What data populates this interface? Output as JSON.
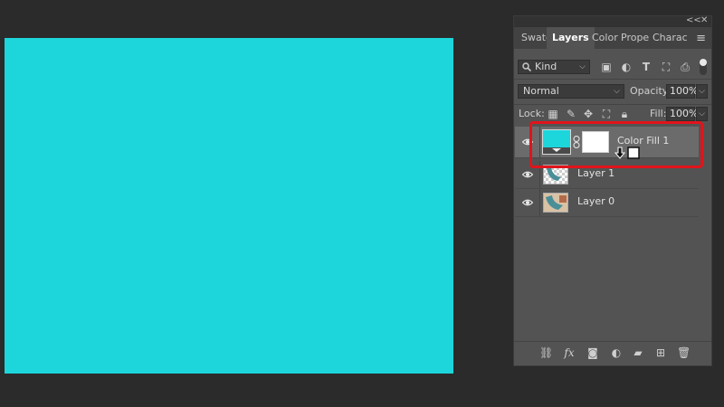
{
  "canvas": {
    "fill_color": "#1dd6dc"
  },
  "panel": {
    "window_controls": {
      "collapse": "<<",
      "close": "✕"
    },
    "tabs": [
      "Swatc",
      "Layers",
      "Color",
      "Prope",
      "Charac"
    ],
    "active_tab": "Layers",
    "filter": {
      "kind_label": "Kind"
    },
    "blend": {
      "mode": "Normal",
      "opacity_label": "Opacity:",
      "opacity_value": "100%"
    },
    "lock": {
      "label": "Lock:",
      "fill_label": "Fill:",
      "fill_value": "100%"
    },
    "layers": [
      {
        "name": "Color Fill 1",
        "selected": true,
        "thumb": "#1dd6dc"
      },
      {
        "name": "Layer 1",
        "selected": false
      },
      {
        "name": "Layer 0",
        "selected": false
      }
    ]
  },
  "annotation": {
    "highlight_color": "#e1141b"
  }
}
